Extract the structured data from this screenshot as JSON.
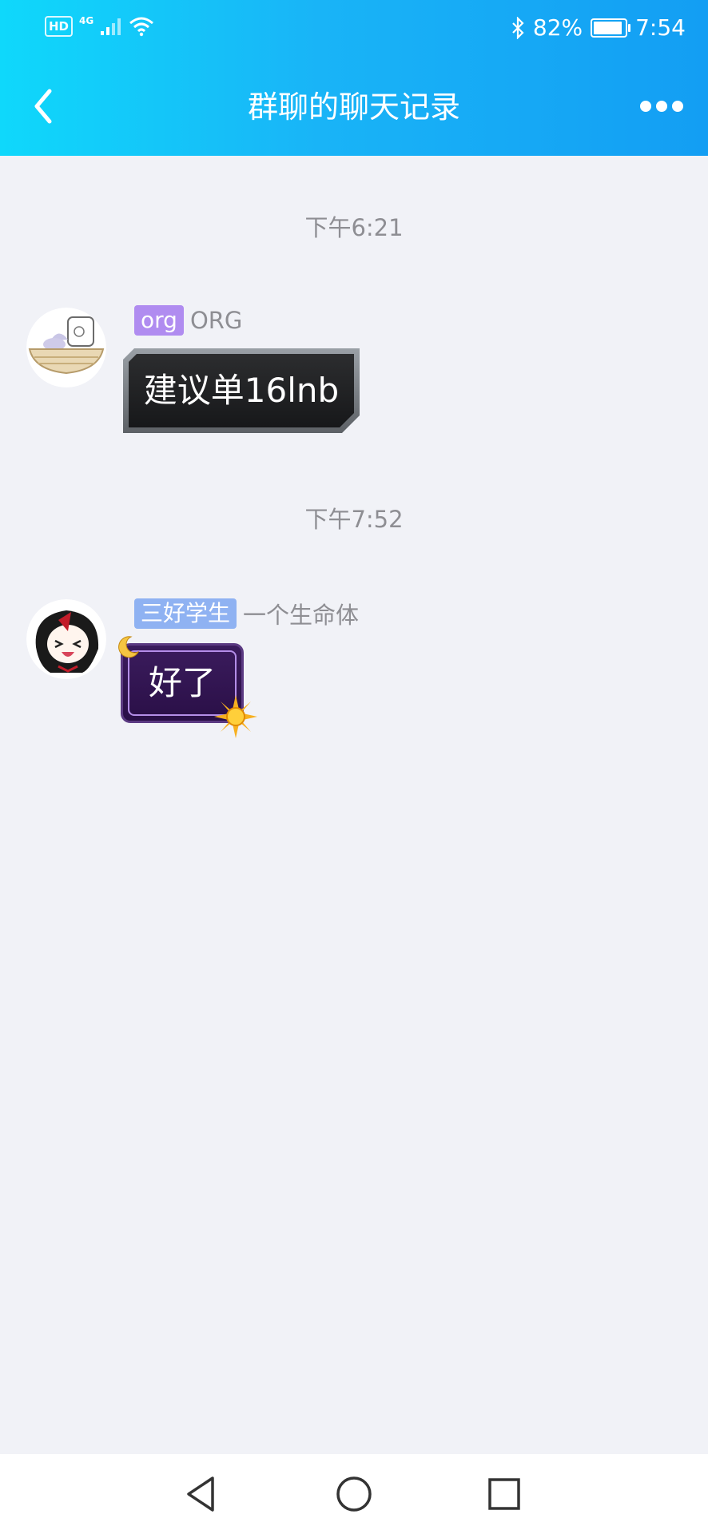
{
  "status_bar": {
    "hd": "HD",
    "network": "4G",
    "battery": "82%",
    "battery_level": 0.82,
    "time": "7:54"
  },
  "header": {
    "title": "群聊的聊天记录"
  },
  "messages": [
    {
      "time": "下午6:21",
      "tag": "org",
      "tag_color": "#b08cf0",
      "name": "ORG",
      "text": "建议单16lnb"
    },
    {
      "time": "下午7:52",
      "tag": "三好学生",
      "tag_color": "#8fb2f2",
      "name": "一个生命体",
      "text": "好了"
    }
  ],
  "colors": {
    "header_start": "#0fd8fb",
    "header_end": "#139ef3",
    "background": "#f1f2f7"
  },
  "icons": {
    "back": "chevron-left-icon",
    "more": "more-dots-icon",
    "nav_back": "triangle-back-icon",
    "nav_home": "circle-home-icon",
    "nav_recents": "square-recents-icon"
  }
}
